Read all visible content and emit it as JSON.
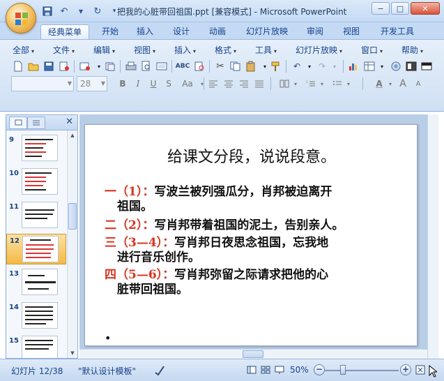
{
  "window": {
    "title": "把我的心脏带回祖国.ppt [兼容模式] - Microsoft PowerPoint",
    "minimize_label": "−",
    "maximize_label": "□",
    "close_label": "✕"
  },
  "tabs": [
    {
      "label": "经典菜单",
      "active": true
    },
    {
      "label": "开始"
    },
    {
      "label": "插入"
    },
    {
      "label": "设计"
    },
    {
      "label": "动画"
    },
    {
      "label": "幻灯片放映"
    },
    {
      "label": "审阅"
    },
    {
      "label": "视图"
    },
    {
      "label": "开发工具"
    }
  ],
  "menu": [
    {
      "label": "全部"
    },
    {
      "label": "文件"
    },
    {
      "label": "编辑"
    },
    {
      "label": "视图"
    },
    {
      "label": "插入"
    },
    {
      "label": "格式"
    },
    {
      "label": "工具"
    },
    {
      "label": "幻灯片放映"
    },
    {
      "label": "窗口"
    },
    {
      "label": "帮助"
    }
  ],
  "format_bar": {
    "font_name": "",
    "font_size": "28",
    "bold_label": "B",
    "italic_label": "I",
    "underline_label": "U",
    "strike_label": "S",
    "case_label": "Aa",
    "font_color_label": "A",
    "grow_label": "A",
    "shrink_label": "A"
  },
  "left_panel": {
    "close_label": "✕",
    "slides": [
      {
        "number": "9"
      },
      {
        "number": "10"
      },
      {
        "number": "11"
      },
      {
        "number": "12",
        "selected": true
      },
      {
        "number": "13"
      },
      {
        "number": "14"
      },
      {
        "number": "15"
      }
    ]
  },
  "slide": {
    "title": "给课文分段，说说段意。",
    "paragraphs": [
      {
        "tag": "一（1）：",
        "text": "写波兰被列强瓜分，肖邦被迫离开",
        "cont": "祖国。"
      },
      {
        "tag": "二（2）：",
        "text": "写肖邦带着祖国的泥土，告别亲人。",
        "cont": ""
      },
      {
        "tag": "三（3—4）：",
        "text": "写肖邦日夜思念祖国，忘我地",
        "cont": "进行音乐创作。"
      },
      {
        "tag": "四（5—6）：",
        "text": "写肖邦弥留之际请求把他的心",
        "cont": "脏带回祖国。"
      }
    ],
    "bullet": "•"
  },
  "status": {
    "slide_counter": "幻灯片 12/38",
    "theme": "\"默认设计模板\"",
    "zoom": "50%",
    "zoom_level_percent": 50
  },
  "colors": {
    "accent_red": "#d8341f",
    "ribbon_blue": "#15428b"
  }
}
